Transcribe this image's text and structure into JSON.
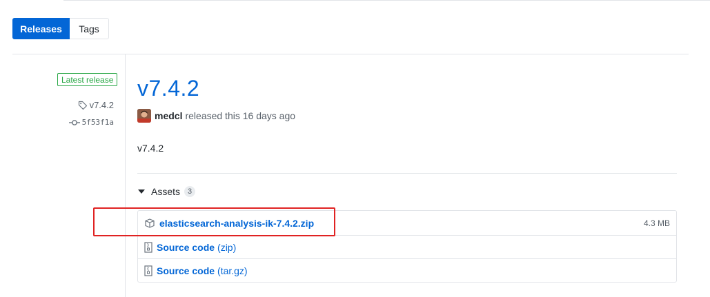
{
  "subnav": {
    "releases_label": "Releases",
    "tags_label": "Tags"
  },
  "release": {
    "badge": "Latest release",
    "tag": "v7.4.2",
    "commit": "5f53f1a",
    "title": "v7.4.2",
    "author": "medcl",
    "released_text": "released this 16 days ago",
    "body": "v7.4.2"
  },
  "assets": {
    "heading": "Assets",
    "count": "3",
    "items": [
      {
        "name": "elasticsearch-analysis-ik-7.4.2.zip",
        "format": "",
        "size": "4.3 MB",
        "icon": "package-icon"
      },
      {
        "name": "Source code",
        "format": "(zip)",
        "size": "",
        "icon": "file-zip-icon"
      },
      {
        "name": "Source code",
        "format": "(tar.gz)",
        "size": "",
        "icon": "file-zip-icon"
      }
    ]
  },
  "colors": {
    "accent": "#0366d6",
    "latest": "#28a745",
    "highlight": "#e02222"
  }
}
